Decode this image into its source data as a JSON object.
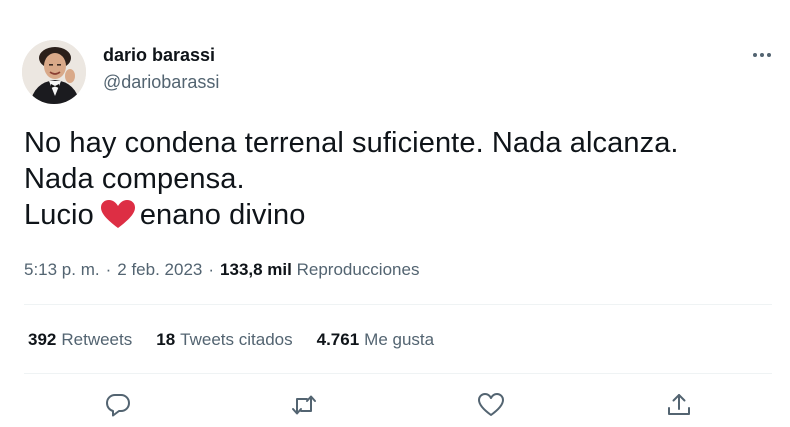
{
  "author": {
    "display_name": "dario barassi",
    "handle": "@dariobarassi",
    "avatar_icon": "profile-photo"
  },
  "tweet": {
    "line1": "No hay condena terrenal suficiente. Nada alcanza.",
    "line2": "Nada compensa.",
    "line3_before": "Lucio",
    "emoji": "red-heart",
    "line3_after": "enano divino"
  },
  "meta": {
    "time": "5:13 p. m.",
    "separator": "·",
    "date": "2 feb. 2023",
    "views_count": "133,8 mil",
    "views_label": "Reproducciones"
  },
  "stats": {
    "retweets_count": "392",
    "retweets_label": "Retweets",
    "quotes_count": "18",
    "quotes_label": "Tweets citados",
    "likes_count": "4.761",
    "likes_label": "Me gusta"
  },
  "icons": {
    "more": "more-horizontal-icon",
    "reply": "reply-icon",
    "retweet": "retweet-icon",
    "like": "like-heart-icon",
    "share": "share-icon"
  },
  "colors": {
    "text": "#0f1419",
    "secondary": "#536471",
    "divider": "#eff3f4",
    "heart": "#dd2e44"
  }
}
